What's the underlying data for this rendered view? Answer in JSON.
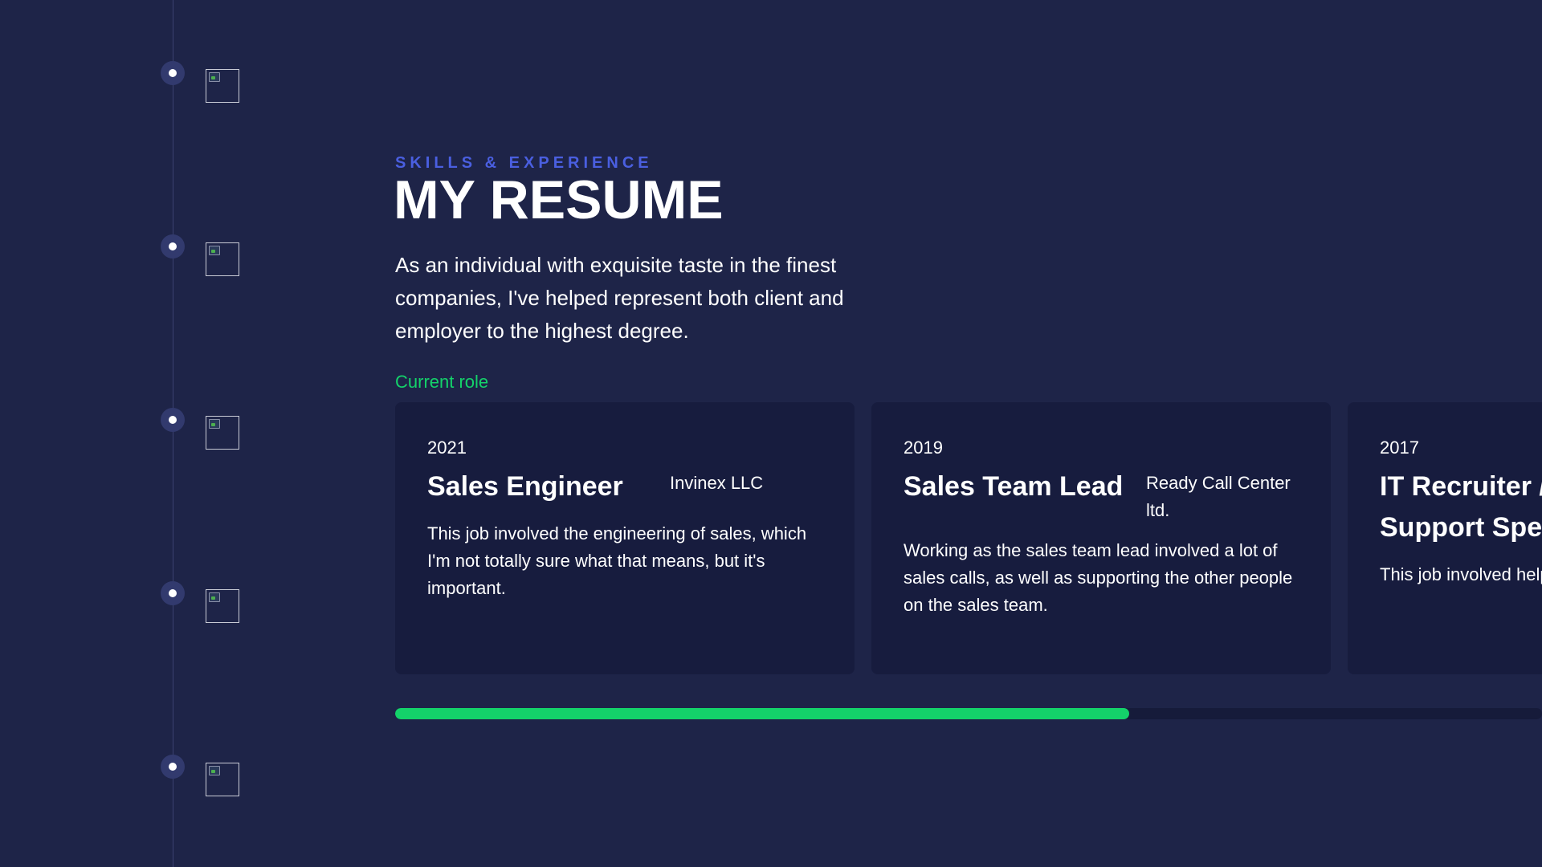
{
  "timeline": {
    "items": [
      {
        "image": "broken-image-icon"
      },
      {
        "image": "broken-image-icon"
      },
      {
        "image": "broken-image-icon"
      },
      {
        "image": "broken-image-icon"
      },
      {
        "image": "broken-image-icon"
      }
    ]
  },
  "header": {
    "eyebrow": "SKILLS & EXPERIENCE",
    "title": "MY RESUME",
    "intro": "As an individual with exquisite taste in the finest companies, I've helped represent both client and employer to the highest degree."
  },
  "current_role_label": "Current role",
  "jobs": [
    {
      "year": "2021",
      "title": "Sales Engineer",
      "company": "Invinex LLC",
      "description": "This job involved the engineering of sales, which I'm not totally sure what that means, but it's important."
    },
    {
      "year": "2019",
      "title": "Sales Team Lead",
      "company": "Ready Call Center ltd.",
      "description": "Working as the sales team lead involved a lot of sales calls, as well as supporting the other people on the sales team."
    },
    {
      "year": "2017",
      "title": "IT Recruiter / Support Spec",
      "company": "",
      "description": "This job involved help supporting the suppo"
    }
  ],
  "scroll_progress": 0.64,
  "colors": {
    "background": "#1e2448",
    "card": "#171c3e",
    "accent_blue": "#4a5fe0",
    "accent_green": "#14d26a"
  }
}
